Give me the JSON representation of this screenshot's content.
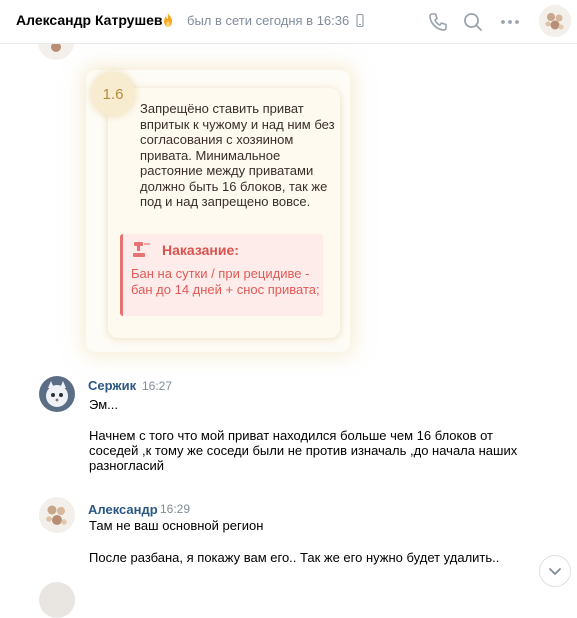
{
  "header": {
    "contact_name": "Александр Катрушев",
    "status": "был в сети сегодня в 16:36",
    "icons": [
      "flame-icon",
      "mobile-phone-icon",
      "phone-call-icon",
      "search-icon",
      "more-icon"
    ]
  },
  "card": {
    "badge": "1.6",
    "rule_text": "Запрещёно ставить приват впритык к чужому и над ним без согласования с хозяином привата. Минимальное растояние между приватами должно быть 16 блоков, так же под и над запрещено вовсе.",
    "punishment_title": "Наказание:",
    "punishment_text": "Бан на сутки / при рецидиве - бан до 14 дней + снос привата;"
  },
  "messages": [
    {
      "author": "Сержик",
      "time": "16:27",
      "lines": [
        "Эм...",
        "Начнем с того что мой приват находился больше чем 16 блоков от соседей ,к тому же соседи были не против изначаль ,до начала наших разногласий"
      ]
    },
    {
      "author": "Александр",
      "time": "16:29",
      "lines": [
        "Там не ваш основной регион",
        "После разбана, я покажу вам его.. Так же его нужно будет удалить.."
      ]
    }
  ],
  "colors": {
    "link": "#2a5885",
    "muted": "#818c99",
    "icon": "#99a2ad",
    "punishment": "#d9534f"
  }
}
